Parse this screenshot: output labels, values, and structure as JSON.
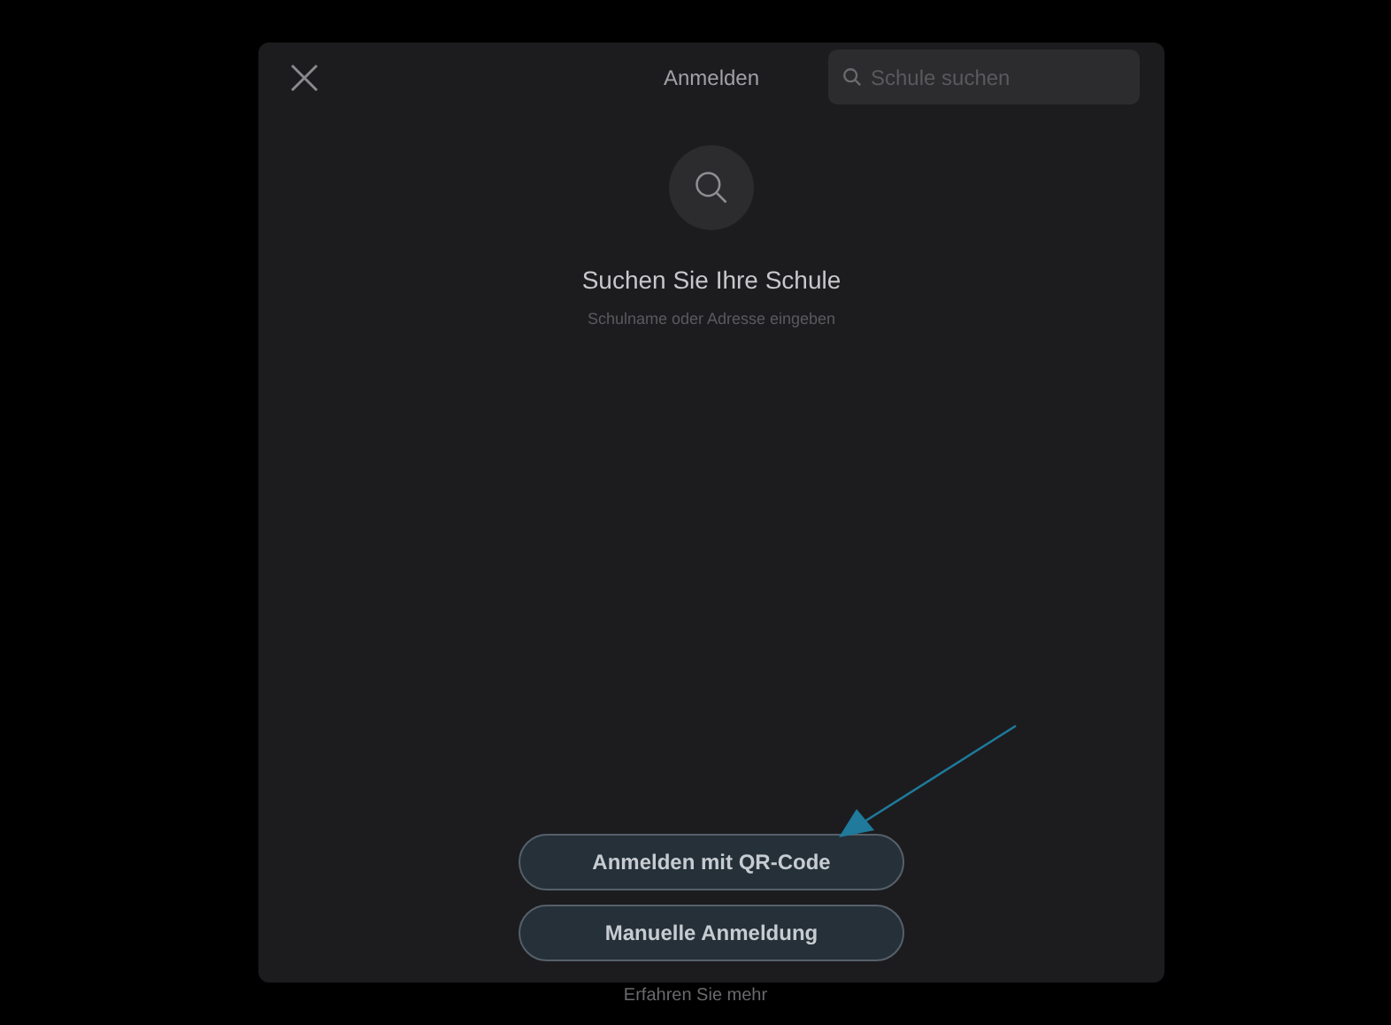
{
  "header": {
    "title": "Anmelden",
    "search": {
      "placeholder": "Schule suchen"
    }
  },
  "empty_state": {
    "heading": "Suchen Sie Ihre Schule",
    "hint": "Schulname oder Adresse eingeben"
  },
  "buttons": [
    "Anmelden mit QR-Code",
    "Manuelle Anmeldung"
  ],
  "footer_link": "Erfahren Sie mehr"
}
